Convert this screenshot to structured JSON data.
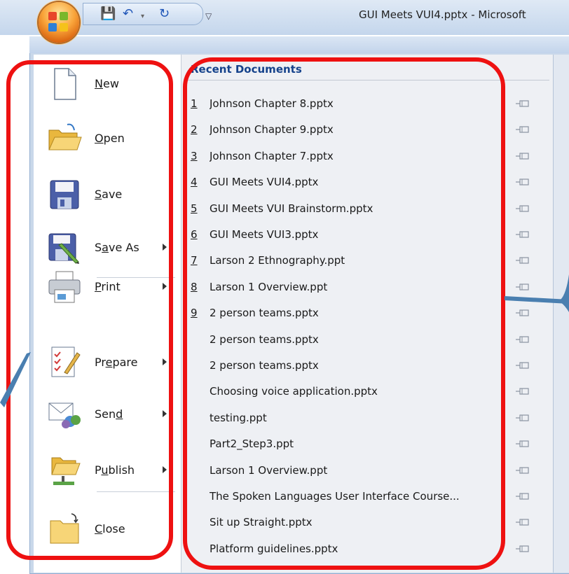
{
  "window": {
    "title": "GUI Meets VUI4.pptx - Microsoft"
  },
  "quick_access": {
    "save_icon": "save-icon",
    "undo_icon": "undo-icon",
    "redo_icon": "redo-icon",
    "customize_icon": "customize-qat-icon"
  },
  "office_button": {
    "icon": "office-logo-icon"
  },
  "menu": {
    "items": [
      {
        "label": "New",
        "access_key": "N",
        "icon": "new-document-icon",
        "has_submenu": false
      },
      {
        "label": "Open",
        "access_key": "O",
        "icon": "open-folder-icon",
        "has_submenu": false
      },
      {
        "label": "Save",
        "access_key": "S",
        "icon": "floppy-disk-icon",
        "has_submenu": false
      },
      {
        "label": "Save As",
        "access_key": "A",
        "icon": "save-as-icon",
        "has_submenu": true
      },
      {
        "label": "Print",
        "access_key": "P",
        "icon": "printer-icon",
        "has_submenu": true
      },
      {
        "label": "Prepare",
        "access_key": "E",
        "icon": "prepare-icon",
        "has_submenu": true
      },
      {
        "label": "Send",
        "access_key": "D",
        "icon": "send-icon",
        "has_submenu": true
      },
      {
        "label": "Publish",
        "access_key": "U",
        "icon": "publish-icon",
        "has_submenu": true
      },
      {
        "label": "Close",
        "access_key": "C",
        "icon": "close-folder-icon",
        "has_submenu": false
      }
    ]
  },
  "recent": {
    "header": "Recent Documents",
    "pin_icon": "pin-icon",
    "items": [
      {
        "num": "1",
        "name": "Johnson Chapter 8.pptx"
      },
      {
        "num": "2",
        "name": "Johnson Chapter 9.pptx"
      },
      {
        "num": "3",
        "name": "Johnson Chapter 7.pptx"
      },
      {
        "num": "4",
        "name": "GUI Meets VUI4.pptx"
      },
      {
        "num": "5",
        "name": "GUI Meets VUI Brainstorm.pptx"
      },
      {
        "num": "6",
        "name": "GUI Meets VUI3.pptx"
      },
      {
        "num": "7",
        "name": "Larson 2 Ethnography.ppt"
      },
      {
        "num": "8",
        "name": "Larson 1 Overview.ppt"
      },
      {
        "num": "9",
        "name": "2 person teams.pptx"
      },
      {
        "num": "",
        "name": "2 person teams.pptx"
      },
      {
        "num": "",
        "name": "2 person teams.pptx"
      },
      {
        "num": "",
        "name": "Choosing voice application.pptx"
      },
      {
        "num": "",
        "name": "testing.ppt"
      },
      {
        "num": "",
        "name": "Part2_Step3.ppt"
      },
      {
        "num": "",
        "name": "Larson 1 Overview.ppt"
      },
      {
        "num": "",
        "name": "The Spoken Languages User Interface Course..."
      },
      {
        "num": "",
        "name": "Sit up Straight.pptx"
      },
      {
        "num": "",
        "name": "Platform guidelines.pptx"
      }
    ]
  },
  "colors": {
    "annotation": "#ee1111",
    "header_text": "#15428b",
    "arrow": "#3d6890"
  }
}
